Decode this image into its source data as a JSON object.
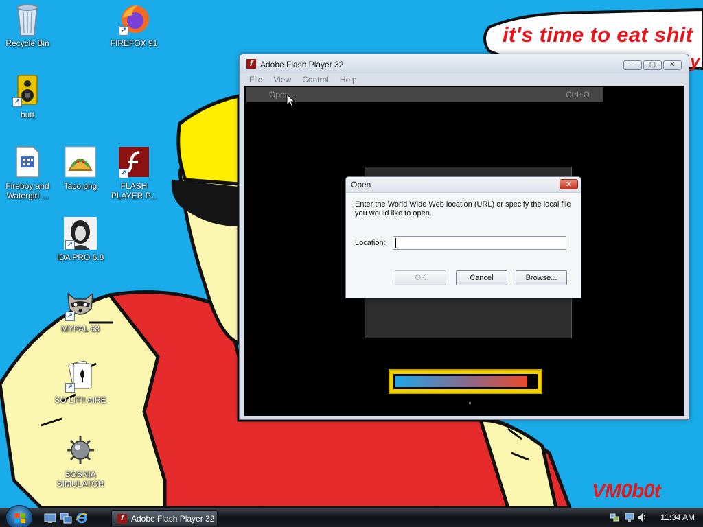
{
  "wallpaper": {
    "speech_text": "it's time to eat shit",
    "speech_text_cont": "y",
    "signature": "VM0b0t",
    "colors": {
      "sky": "#1aabea",
      "skin": "#fbf6b0",
      "shirt": "#e52b2b",
      "hat": "#ffee00",
      "text_red": "#e8141b"
    }
  },
  "desktop_icons": [
    {
      "label": "Recycle Bin",
      "icon": "recycle-bin-icon"
    },
    {
      "label": "FIREFOX 91",
      "icon": "firefox-icon"
    },
    {
      "label": "butt",
      "icon": "speaker-icon"
    },
    {
      "label": "Fireboy and Watergirl ...",
      "icon": "document-icon"
    },
    {
      "label": "Taco.png",
      "icon": "taco-icon"
    },
    {
      "label": "FLASH PLAYER P...",
      "icon": "flash-icon"
    },
    {
      "label": "IDA PRO 6.8",
      "icon": "ida-portrait-icon"
    },
    {
      "label": "MYPAL 68",
      "icon": "raccoon-icon"
    },
    {
      "label": "SO LIT!! AIRE",
      "icon": "cards-icon"
    },
    {
      "label": "BOSNIA SIMULATOR",
      "icon": "mine-icon"
    }
  ],
  "flash_window": {
    "title": "Adobe Flash Player 32",
    "controls": {
      "minimize": "—",
      "maximize": "▢",
      "close": "✕"
    },
    "menu": [
      "File",
      "View",
      "Control",
      "Help"
    ],
    "open_item": {
      "label": "Open...",
      "shortcut": "Ctrl+O"
    },
    "loading_progress": 0.94
  },
  "open_dialog": {
    "title": "Open",
    "close": "✕",
    "message": "Enter the World Wide Web location (URL) or specify the local file you would like to open.",
    "location_label": "Location:",
    "location_value": "",
    "buttons": {
      "ok": "OK",
      "cancel": "Cancel",
      "browse": "Browse..."
    }
  },
  "taskbar": {
    "task_label": "Adobe Flash Player 32",
    "clock": "11:34 AM",
    "quick_launch": [
      "show-desktop-icon",
      "switch-windows-icon",
      "internet-explorer-icon"
    ],
    "tray": [
      "network-icon",
      "volume-icon",
      "display-icon"
    ]
  }
}
